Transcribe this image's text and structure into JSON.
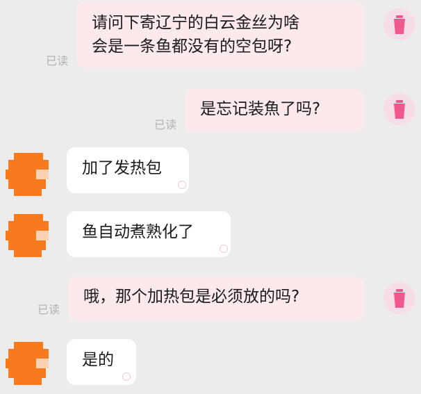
{
  "messages": [
    {
      "side": "out",
      "lines": [
        "请问下寄辽宁的白云金丝为啥",
        "会是一条鱼都没有的空包呀?"
      ],
      "status": "已读"
    },
    {
      "side": "out",
      "lines": [
        "是忘记装魚了吗?"
      ],
      "status": "已读"
    },
    {
      "side": "in",
      "lines": [
        "加了发热包"
      ]
    },
    {
      "side": "in",
      "lines": [
        "鱼自动煮熟化了"
      ]
    },
    {
      "side": "out",
      "lines": [
        "哦，那个加热包是必须放的吗?"
      ],
      "status": "已读"
    },
    {
      "side": "in",
      "lines": [
        "是的"
      ]
    }
  ],
  "colors": {
    "background": "#ececec",
    "outgoing_bubble": "#fbe9ec",
    "incoming_bubble": "#ffffff",
    "avatar_pink": "#f6dde7",
    "cup_icon": "#ee5a8f",
    "avatar_orange": "#f77a1c"
  },
  "icons": {
    "self_avatar": "pink-cup-icon",
    "other_avatar": "pixelated-orange-avatar"
  }
}
